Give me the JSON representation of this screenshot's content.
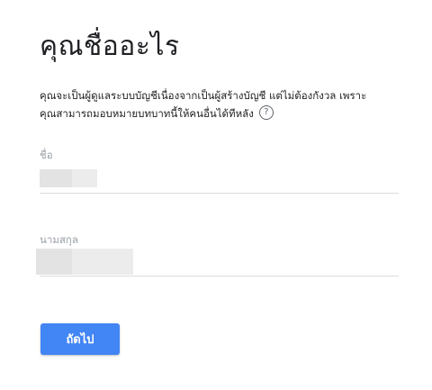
{
  "page": {
    "title": "คุณชื่ออะไร",
    "description_line1": "คุณจะเป็นผู้ดูแลระบบบัญชีเนื่องจากเป็นผู้สร้างบัญชี แต่ไม่ต้องกังวล เพราะ",
    "description_line2": "คุณสามารถมอบหมายบทบาทนี้ให้คนอื่นได้ทีหลัง",
    "help_icon": "help-circle-icon",
    "help_glyph": "?"
  },
  "form": {
    "first_name": {
      "label": "ชื่อ",
      "value": "",
      "redacted": true
    },
    "last_name": {
      "label": "นามสกุล",
      "value": "",
      "redacted": true
    }
  },
  "actions": {
    "next_label": "ถัดไป"
  },
  "colors": {
    "primary_button": "#4285f4",
    "label_gray": "#9aa0a6",
    "underline": "#dadce0"
  }
}
